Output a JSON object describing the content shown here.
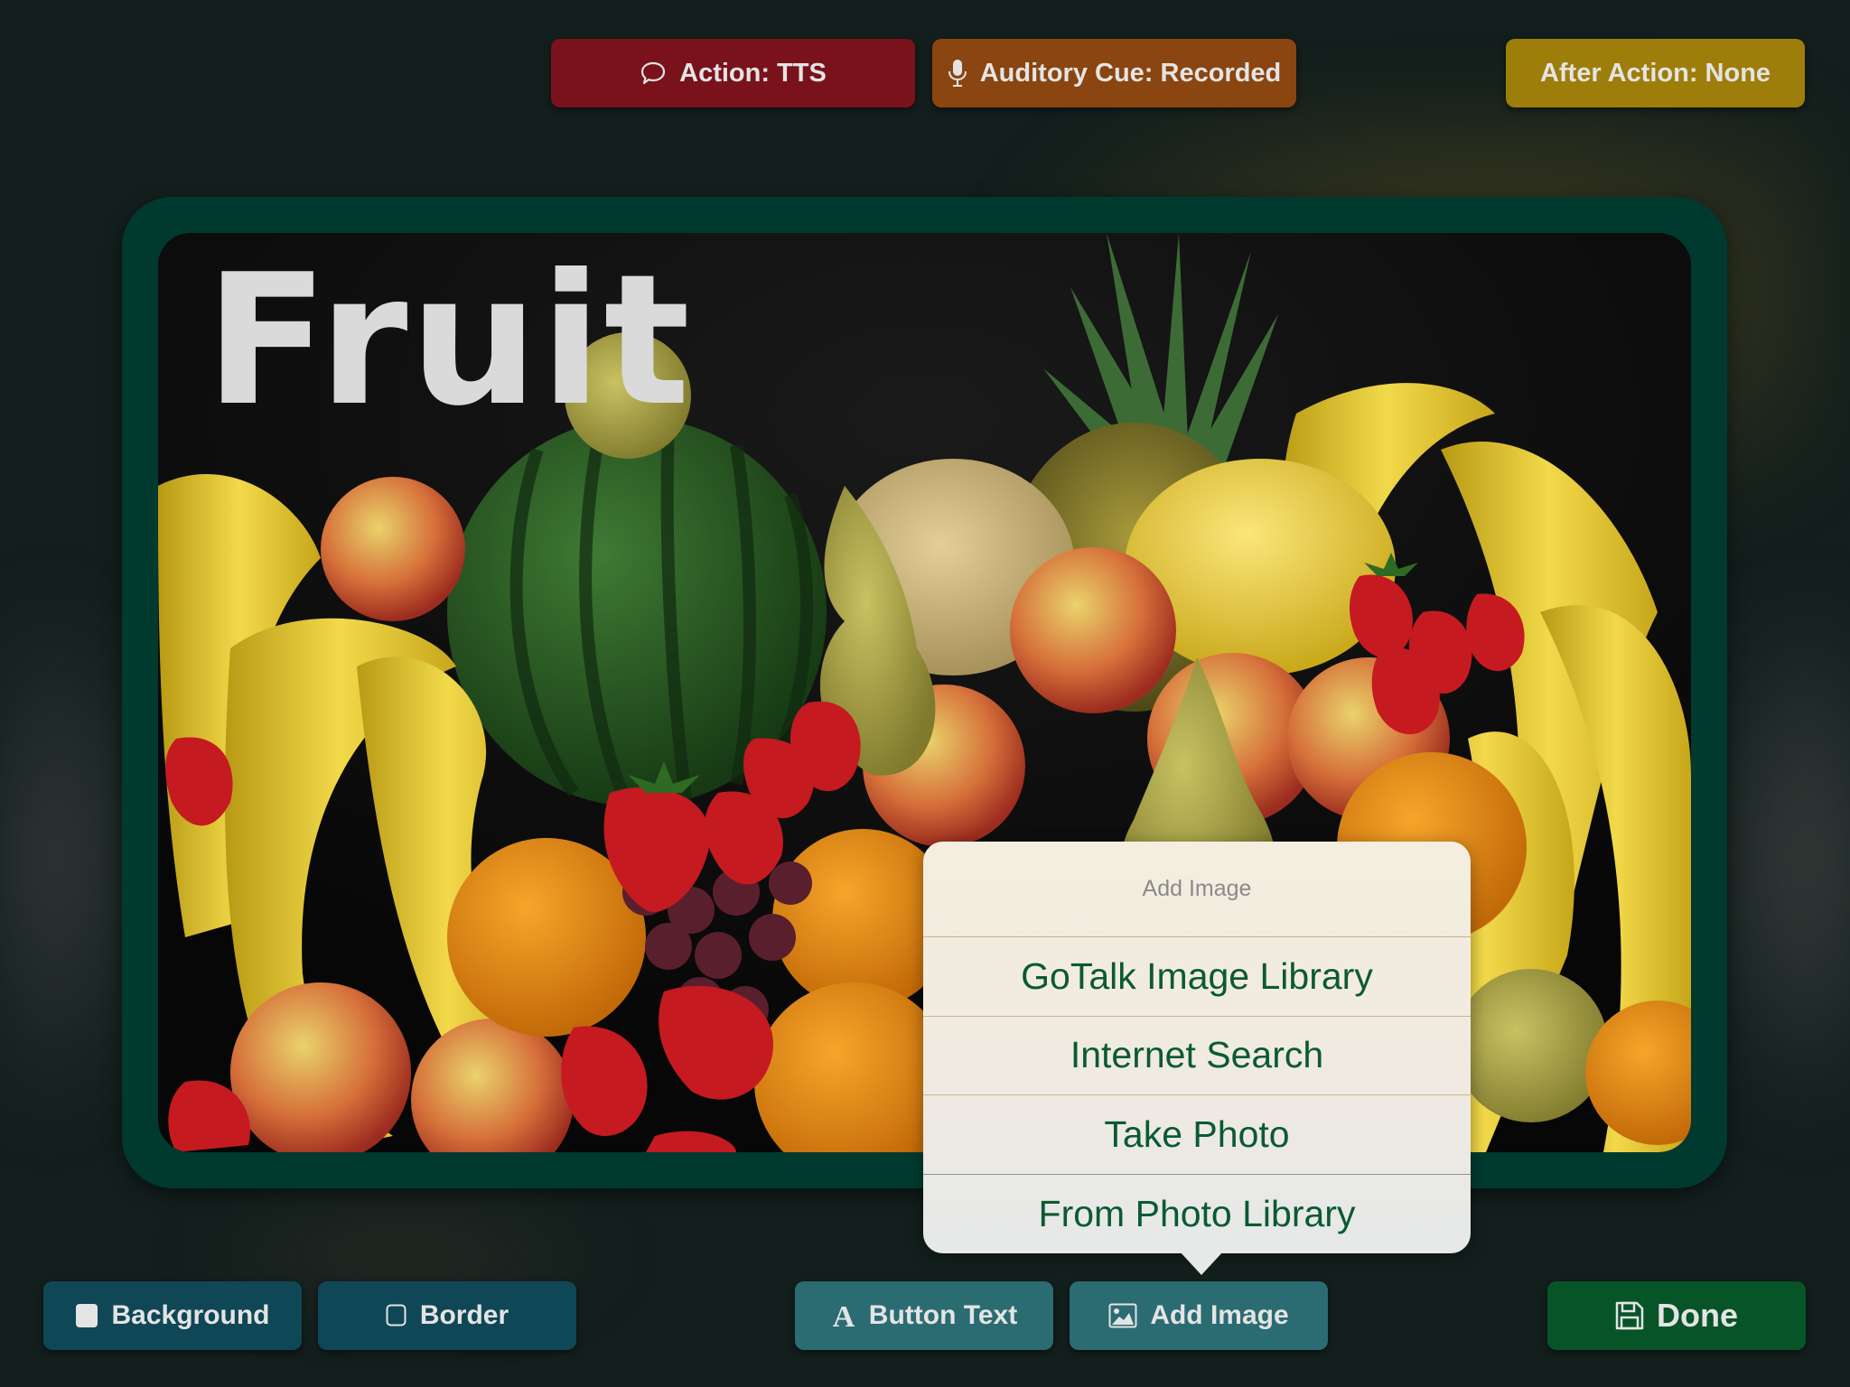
{
  "top_bar": {
    "action_button": {
      "label": "Action: TTS",
      "icon": "speech-bubble-icon",
      "color": "#7a121b"
    },
    "auditory_cue_button": {
      "label": "Auditory Cue: Recorded",
      "icon": "microphone-icon",
      "color": "#8a4510"
    },
    "after_action_button": {
      "label": "After Action: None",
      "color": "#9e7e0a"
    }
  },
  "card": {
    "label": "Fruit",
    "frame_color": "#003a2f",
    "image_description": "Assorted fruit: watermelon, pineapple, bananas, apples, pears, oranges, strawberries, grapes, melons"
  },
  "popover": {
    "title": "Add Image",
    "items": [
      {
        "label": "GoTalk Image Library"
      },
      {
        "label": "Internet Search"
      },
      {
        "label": "Take Photo"
      },
      {
        "label": "From Photo Library"
      }
    ],
    "item_text_color": "#0b5a32"
  },
  "bottom_bar": {
    "background_button": {
      "label": "Background",
      "icon": "filled-square-icon"
    },
    "border_button": {
      "label": "Border",
      "icon": "outline-square-icon"
    },
    "button_text_button": {
      "label": "Button Text",
      "icon": "letter-a-icon"
    },
    "add_image_button": {
      "label": "Add Image",
      "icon": "image-icon"
    },
    "done_button": {
      "label": "Done",
      "icon": "floppy-disk-icon",
      "color": "#075428"
    }
  }
}
